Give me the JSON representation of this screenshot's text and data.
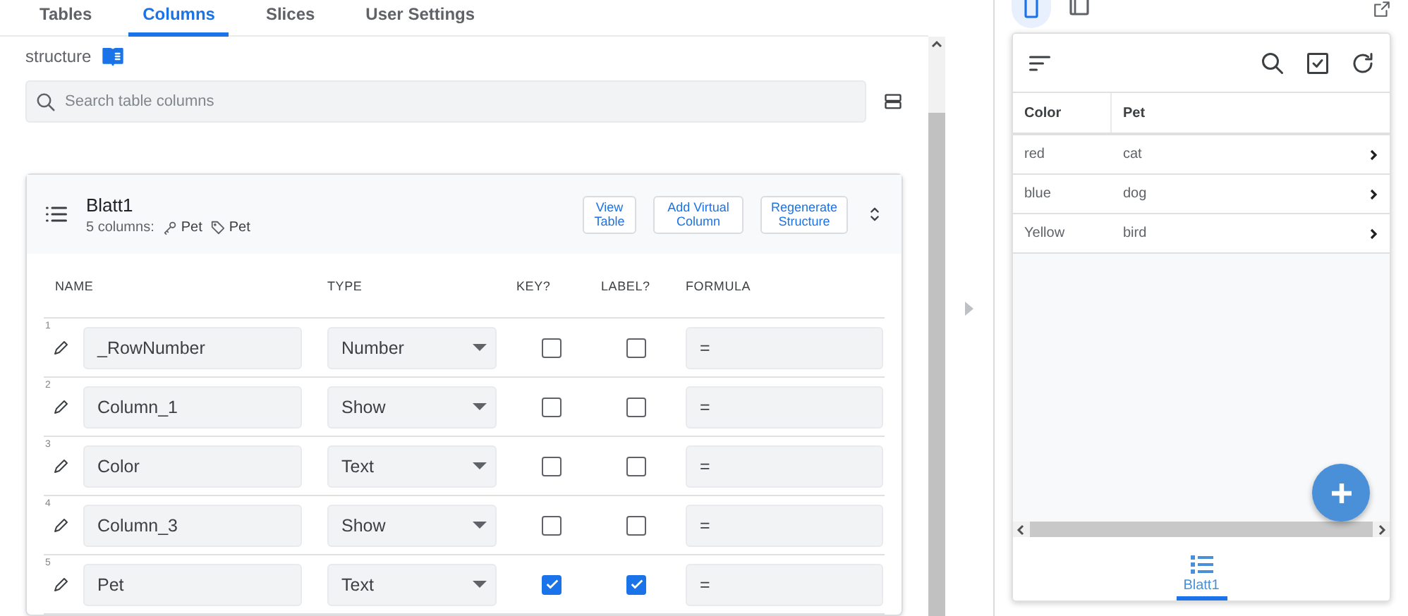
{
  "tabs": [
    {
      "label": "Tables",
      "selected": false
    },
    {
      "label": "Columns",
      "selected": true
    },
    {
      "label": "Slices",
      "selected": false
    },
    {
      "label": "User Settings",
      "selected": false
    }
  ],
  "structure_label": "structure",
  "search": {
    "placeholder": "Search table columns"
  },
  "table_card": {
    "name": "Blatt1",
    "column_count": "5 columns:",
    "key_column": "Pet",
    "label_column": "Pet",
    "buttons": [
      {
        "label": "View Table"
      },
      {
        "label": "Add Virtual Column"
      },
      {
        "label": "Regenerate Structure"
      }
    ],
    "columns": [
      "NAME",
      "TYPE",
      "KEY?",
      "LABEL?",
      "FORMULA"
    ],
    "rows": [
      {
        "number": "1",
        "name": "_RowNumber",
        "type": "Number",
        "key": false,
        "label": false,
        "formula": "="
      },
      {
        "number": "2",
        "name": "Column_1",
        "type": "Show",
        "key": false,
        "label": false,
        "formula": "="
      },
      {
        "number": "3",
        "name": "Color",
        "type": "Text",
        "key": false,
        "label": false,
        "formula": "="
      },
      {
        "number": "4",
        "name": "Column_3",
        "type": "Show",
        "key": false,
        "label": false,
        "formula": "="
      },
      {
        "number": "5",
        "name": "Pet",
        "type": "Text",
        "key": true,
        "label": true,
        "formula": "="
      }
    ]
  },
  "preview": {
    "devices": [
      {
        "kind": "phone",
        "selected": true
      },
      {
        "kind": "tablet",
        "selected": false
      }
    ],
    "columns": [
      "Color",
      "Pet"
    ],
    "rows": [
      [
        "red",
        "cat"
      ],
      [
        "blue",
        "dog"
      ],
      [
        "Yellow",
        "bird"
      ]
    ],
    "nav": [
      {
        "label": "Blatt1",
        "selected": true
      }
    ]
  }
}
